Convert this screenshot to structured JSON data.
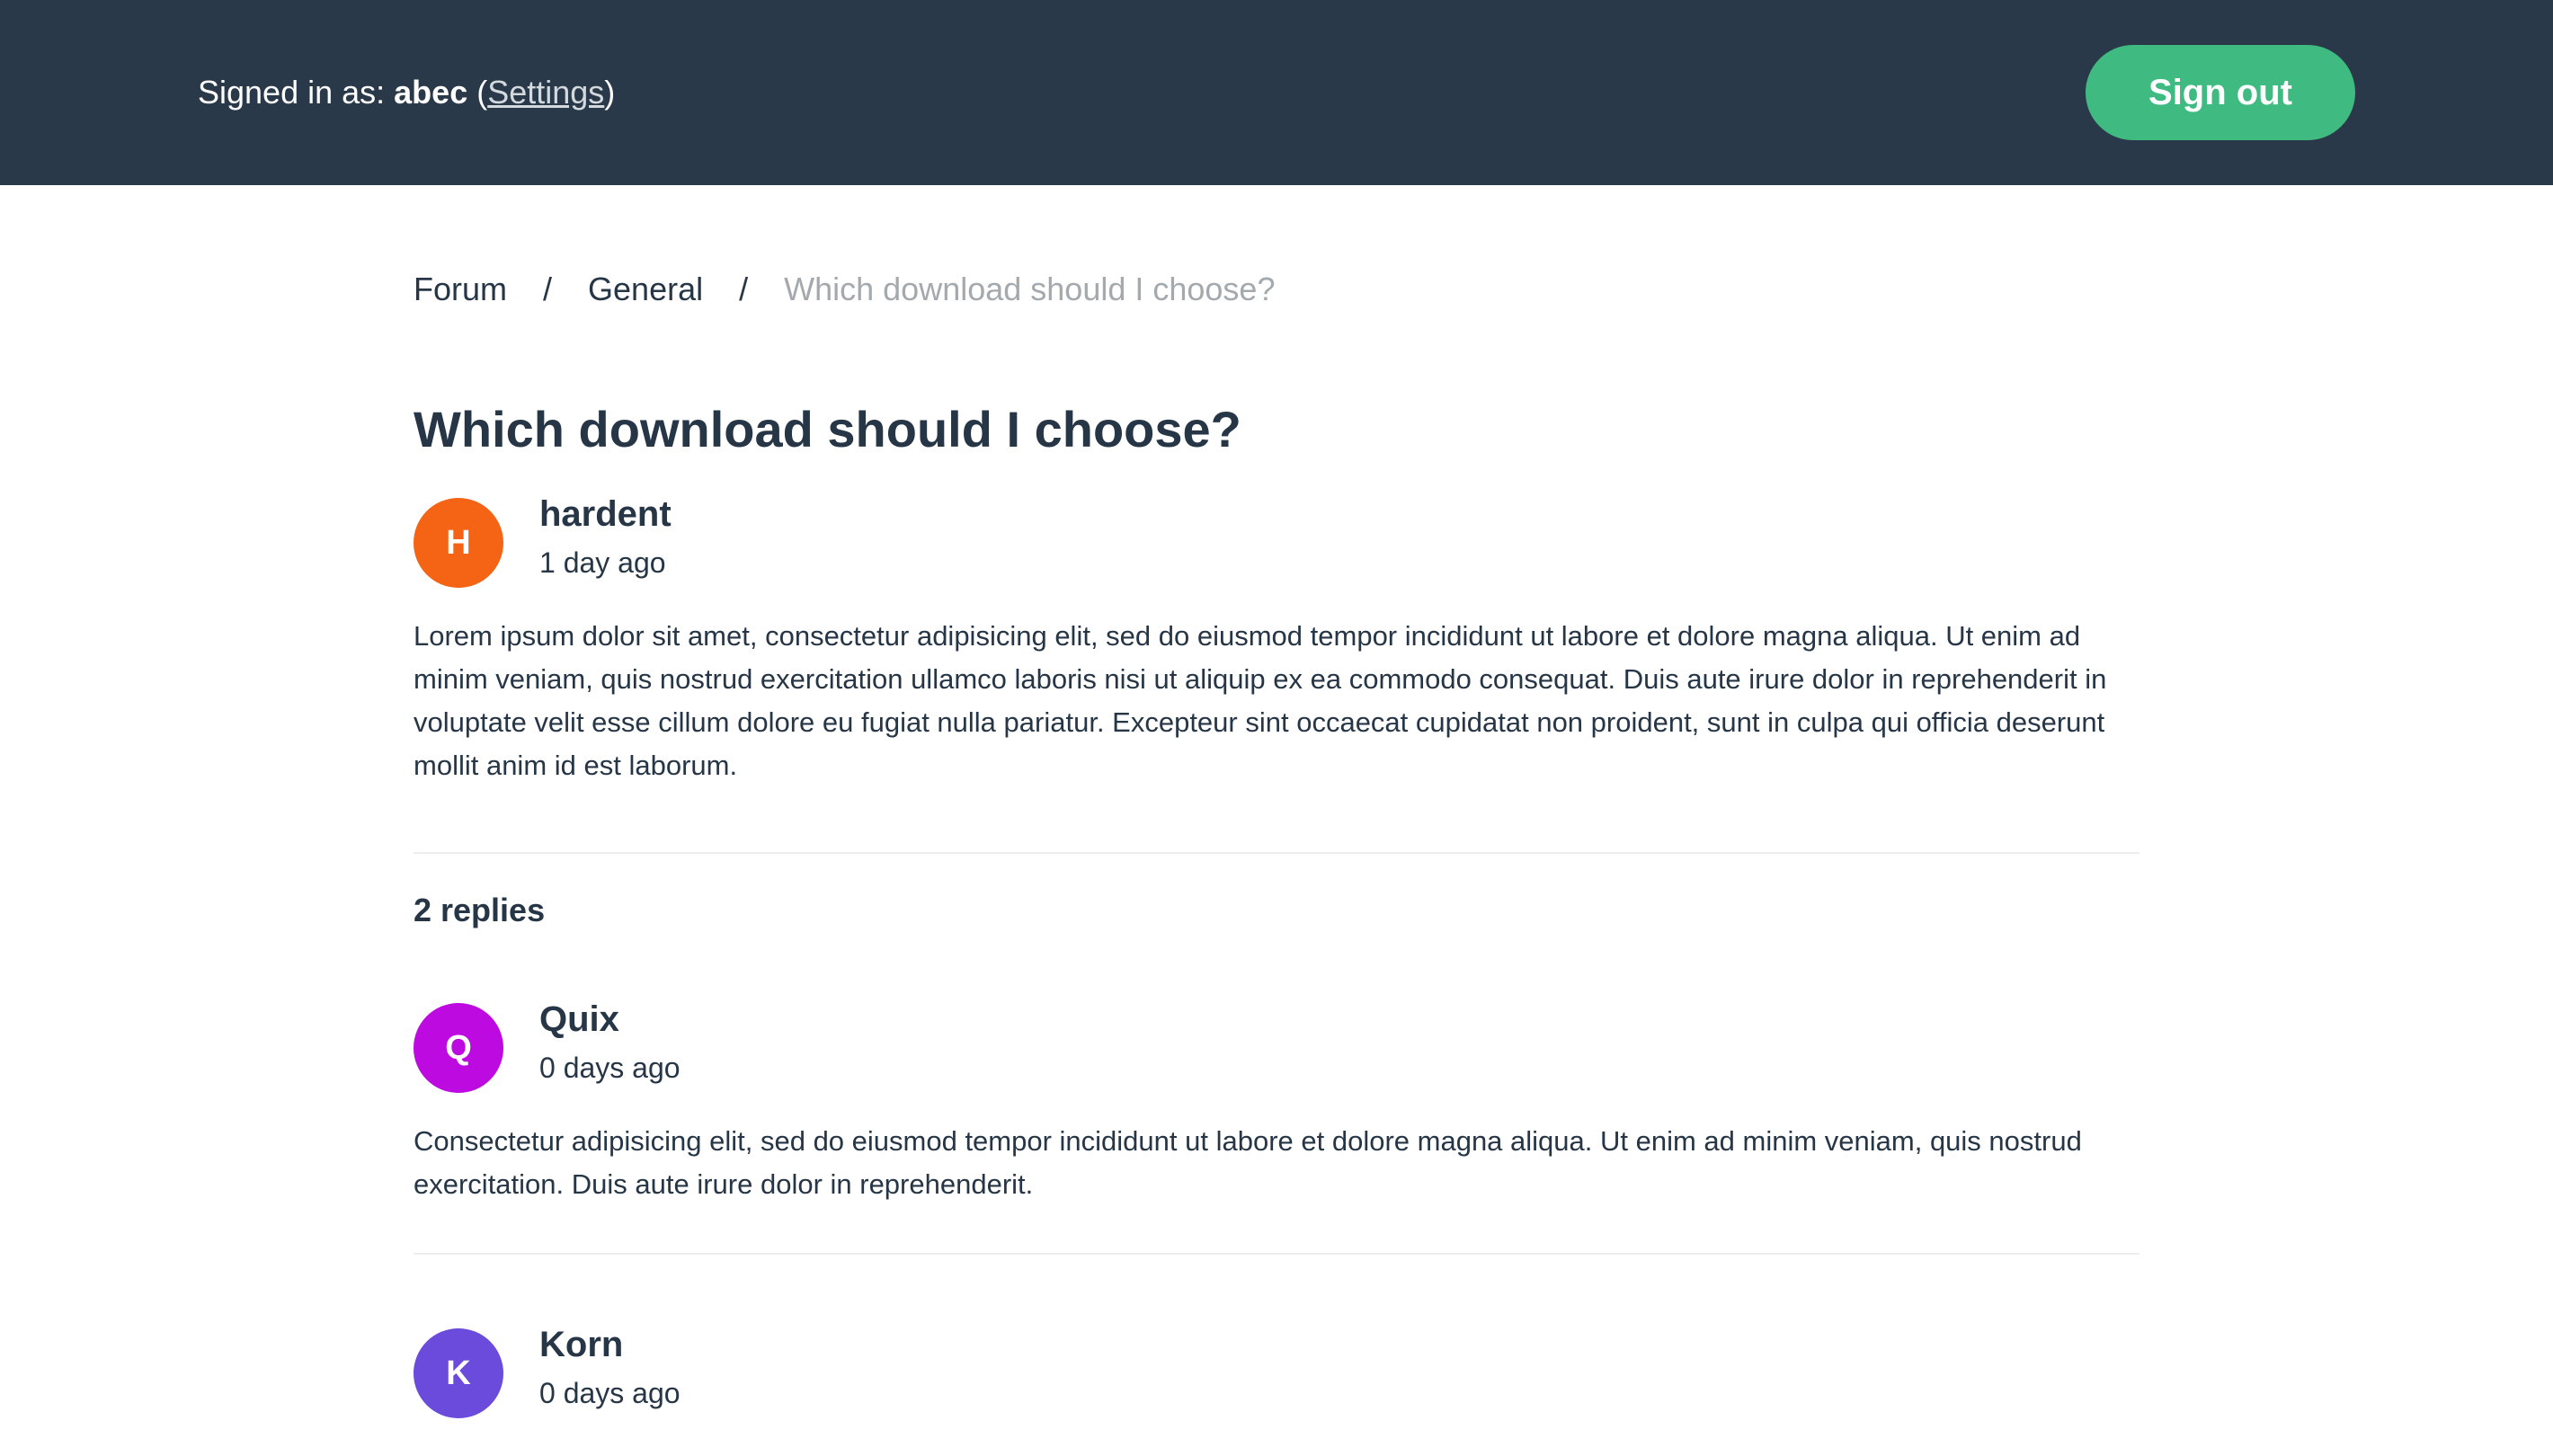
{
  "header": {
    "signed_in_prefix": "Signed in as: ",
    "username": "abec",
    "open_paren": " (",
    "settings_label": "Settings",
    "close_paren": ")",
    "sign_out_label": "Sign out"
  },
  "breadcrumb": {
    "items": [
      "Forum",
      "General"
    ],
    "separator": "/",
    "current": "Which download should I choose?"
  },
  "topic": {
    "title": "Which download should I choose?",
    "author": "hardent",
    "avatar_letter": "H",
    "avatar_color": "#f46414",
    "time": "1 day ago",
    "body": "Lorem ipsum dolor sit amet, consectetur adipisicing elit, sed do eiusmod tempor incididunt ut labore et dolore magna aliqua. Ut enim ad minim veniam, quis nostrud exercitation ullamco laboris nisi ut aliquip ex ea commodo consequat. Duis aute irure dolor in reprehenderit in voluptate velit esse cillum dolore eu fugiat nulla pariatur. Excepteur sint occaecat cupidatat non proident, sunt in culpa qui officia deserunt mollit anim id est laborum."
  },
  "replies": {
    "count_label": "2 replies",
    "items": [
      {
        "author": "Quix",
        "avatar_letter": "Q",
        "avatar_color": "#bd0ae0",
        "time": "0 days ago",
        "body": "Consectetur adipisicing elit, sed do eiusmod tempor incididunt ut labore et dolore magna aliqua. Ut enim ad minim veniam, quis nostrud exercitation. Duis aute irure dolor in reprehenderit."
      },
      {
        "author": "Korn",
        "avatar_letter": "K",
        "avatar_color": "#6a4bdc",
        "time": "0 days ago",
        "body": ""
      }
    ]
  },
  "colors": {
    "topbar": "#29394a",
    "accent": "#3fbb81",
    "text": "#263646",
    "muted": "#a4a9ae"
  }
}
